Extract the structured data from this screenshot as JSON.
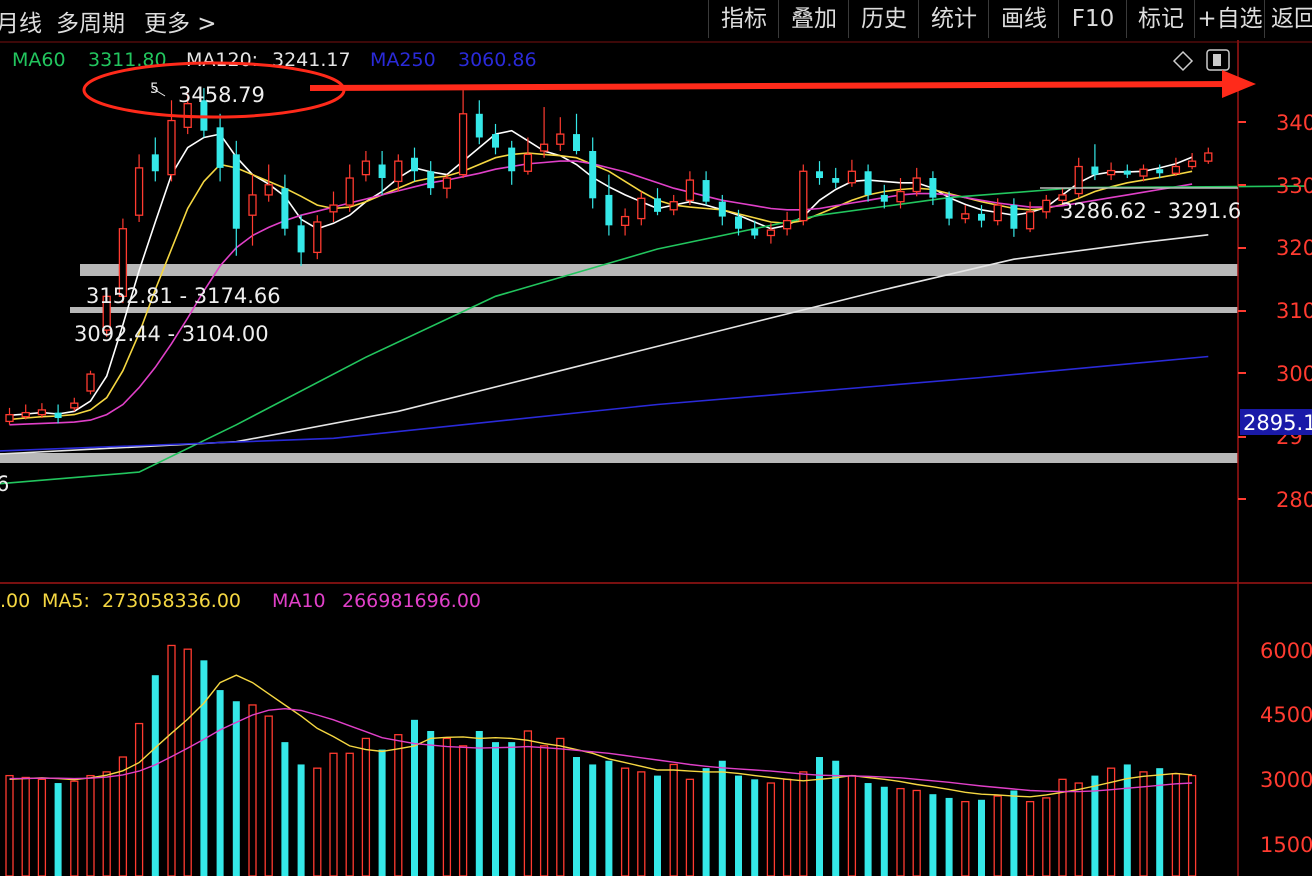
{
  "toolbar": {
    "left": [
      "月线",
      "多周期",
      "更多 >"
    ],
    "right": [
      "指标",
      "叠加",
      "历史",
      "统计",
      "画线",
      "F10",
      "标记",
      "+自选",
      "返回"
    ]
  },
  "price_panel": {
    "ma_legend": [
      {
        "label": "MA60",
        "value": "3311.80",
        "color": "#22c55e"
      },
      {
        "label": "MA120:",
        "value": "3241.17",
        "color": "#e5e5e5"
      },
      {
        "label": "MA250",
        "value": "3060.86",
        "color": "#2a2ad8"
      }
    ],
    "high_label": "3458.79",
    "high_marker": "5",
    "ranges": [
      "3152.81 - 3174.66",
      "3092.44 - 3104.00",
      "3286.62 - 3291.6"
    ],
    "left_edge_label": "6",
    "current_price_tag": "2895.1",
    "y_axis_labels": [
      "340",
      "330",
      "320",
      "310",
      "300",
      "29",
      "280"
    ]
  },
  "volume_panel": {
    "legend": [
      {
        "label": ".00",
        "value": "",
        "color": "#f5d742"
      },
      {
        "label": "MA5:",
        "value": "273058336.00",
        "color": "#f5d742"
      },
      {
        "label": "MA10",
        "value": "266981696.00",
        "color": "#e040c8"
      }
    ],
    "y_axis_labels": [
      "6000",
      "4500",
      "3000",
      "1500"
    ]
  },
  "colors": {
    "up": "#ff3b30",
    "down": "#35e8e8",
    "axis": "#a01515",
    "ma_white": "#ffffff",
    "ma_yellow": "#f5d742",
    "ma_pink": "#e040c8",
    "ma60": "#22c55e",
    "ma120": "#e5e5e5",
    "ma250": "#2a2ad8",
    "annotation": "#ff2a1a"
  },
  "chart_data": {
    "type": "candlestick",
    "price_range": [
      2760,
      3470
    ],
    "candles": [
      {
        "o": 2965,
        "c": 2975,
        "h": 2985,
        "l": 2960
      },
      {
        "o": 2972,
        "c": 2978,
        "h": 2990,
        "l": 2968
      },
      {
        "o": 2975,
        "c": 2982,
        "h": 2992,
        "l": 2970
      },
      {
        "o": 2978,
        "c": 2970,
        "h": 2990,
        "l": 2962
      },
      {
        "o": 2985,
        "c": 2992,
        "h": 3000,
        "l": 2980
      },
      {
        "o": 3010,
        "c": 3035,
        "h": 3040,
        "l": 3005
      },
      {
        "o": 3100,
        "c": 3150,
        "h": 3155,
        "l": 3090
      },
      {
        "o": 3150,
        "c": 3250,
        "h": 3265,
        "l": 3140
      },
      {
        "o": 3270,
        "c": 3340,
        "h": 3360,
        "l": 3260
      },
      {
        "o": 3360,
        "c": 3335,
        "h": 3385,
        "l": 3320
      },
      {
        "o": 3330,
        "c": 3410,
        "h": 3440,
        "l": 3320
      },
      {
        "o": 3400,
        "c": 3435,
        "h": 3450,
        "l": 3390
      },
      {
        "o": 3440,
        "c": 3395,
        "h": 3458,
        "l": 3385
      },
      {
        "o": 3400,
        "c": 3340,
        "h": 3420,
        "l": 3320
      },
      {
        "o": 3360,
        "c": 3250,
        "h": 3380,
        "l": 3210
      },
      {
        "o": 3270,
        "c": 3300,
        "h": 3330,
        "l": 3225
      },
      {
        "o": 3300,
        "c": 3315,
        "h": 3345,
        "l": 3290
      },
      {
        "o": 3310,
        "c": 3250,
        "h": 3330,
        "l": 3240
      },
      {
        "o": 3255,
        "c": 3215,
        "h": 3270,
        "l": 3195
      },
      {
        "o": 3215,
        "c": 3260,
        "h": 3270,
        "l": 3205
      },
      {
        "o": 3275,
        "c": 3285,
        "h": 3305,
        "l": 3260
      },
      {
        "o": 3285,
        "c": 3325,
        "h": 3345,
        "l": 3275
      },
      {
        "o": 3330,
        "c": 3350,
        "h": 3365,
        "l": 3320
      },
      {
        "o": 3345,
        "c": 3325,
        "h": 3365,
        "l": 3300
      },
      {
        "o": 3320,
        "c": 3350,
        "h": 3360,
        "l": 3305
      },
      {
        "o": 3355,
        "c": 3335,
        "h": 3370,
        "l": 3320
      },
      {
        "o": 3335,
        "c": 3310,
        "h": 3350,
        "l": 3300
      },
      {
        "o": 3310,
        "c": 3325,
        "h": 3330,
        "l": 3295
      },
      {
        "o": 3330,
        "c": 3420,
        "h": 3455,
        "l": 3325
      },
      {
        "o": 3420,
        "c": 3385,
        "h": 3440,
        "l": 3375
      },
      {
        "o": 3390,
        "c": 3370,
        "h": 3405,
        "l": 3360
      },
      {
        "o": 3370,
        "c": 3335,
        "h": 3380,
        "l": 3315
      },
      {
        "o": 3335,
        "c": 3360,
        "h": 3385,
        "l": 3330
      },
      {
        "o": 3365,
        "c": 3375,
        "h": 3430,
        "l": 3355
      },
      {
        "o": 3375,
        "c": 3390,
        "h": 3415,
        "l": 3365
      },
      {
        "o": 3390,
        "c": 3365,
        "h": 3420,
        "l": 3360
      },
      {
        "o": 3365,
        "c": 3295,
        "h": 3385,
        "l": 3280
      },
      {
        "o": 3300,
        "c": 3255,
        "h": 3330,
        "l": 3240
      },
      {
        "o": 3255,
        "c": 3268,
        "h": 3280,
        "l": 3240
      },
      {
        "o": 3265,
        "c": 3295,
        "h": 3305,
        "l": 3255
      },
      {
        "o": 3295,
        "c": 3275,
        "h": 3310,
        "l": 3270
      },
      {
        "o": 3278,
        "c": 3290,
        "h": 3300,
        "l": 3270
      },
      {
        "o": 3292,
        "c": 3322,
        "h": 3335,
        "l": 3285
      },
      {
        "o": 3322,
        "c": 3290,
        "h": 3335,
        "l": 3285
      },
      {
        "o": 3290,
        "c": 3268,
        "h": 3300,
        "l": 3255
      },
      {
        "o": 3268,
        "c": 3250,
        "h": 3278,
        "l": 3240
      },
      {
        "o": 3250,
        "c": 3240,
        "h": 3262,
        "l": 3235
      },
      {
        "o": 3240,
        "c": 3248,
        "h": 3258,
        "l": 3228
      },
      {
        "o": 3250,
        "c": 3262,
        "h": 3275,
        "l": 3240
      },
      {
        "o": 3262,
        "c": 3335,
        "h": 3345,
        "l": 3255
      },
      {
        "o": 3335,
        "c": 3325,
        "h": 3350,
        "l": 3315
      },
      {
        "o": 3325,
        "c": 3318,
        "h": 3340,
        "l": 3310
      },
      {
        "o": 3318,
        "c": 3335,
        "h": 3352,
        "l": 3312
      },
      {
        "o": 3335,
        "c": 3300,
        "h": 3345,
        "l": 3290
      },
      {
        "o": 3300,
        "c": 3290,
        "h": 3315,
        "l": 3280
      },
      {
        "o": 3290,
        "c": 3305,
        "h": 3325,
        "l": 3280
      },
      {
        "o": 3305,
        "c": 3325,
        "h": 3340,
        "l": 3298
      },
      {
        "o": 3325,
        "c": 3296,
        "h": 3335,
        "l": 3285
      },
      {
        "o": 3296,
        "c": 3265,
        "h": 3305,
        "l": 3255
      },
      {
        "o": 3265,
        "c": 3272,
        "h": 3285,
        "l": 3258
      },
      {
        "o": 3272,
        "c": 3262,
        "h": 3285,
        "l": 3252
      },
      {
        "o": 3262,
        "c": 3285,
        "h": 3295,
        "l": 3255
      },
      {
        "o": 3285,
        "c": 3250,
        "h": 3295,
        "l": 3238
      },
      {
        "o": 3250,
        "c": 3275,
        "h": 3290,
        "l": 3245
      },
      {
        "o": 3275,
        "c": 3292,
        "h": 3300,
        "l": 3265
      },
      {
        "o": 3292,
        "c": 3300,
        "h": 3310,
        "l": 3285
      },
      {
        "o": 3302,
        "c": 3342,
        "h": 3355,
        "l": 3295
      },
      {
        "o": 3342,
        "c": 3330,
        "h": 3375,
        "l": 3322
      },
      {
        "o": 3330,
        "c": 3336,
        "h": 3348,
        "l": 3322
      },
      {
        "o": 3336,
        "c": 3330,
        "h": 3345,
        "l": 3325
      },
      {
        "o": 3328,
        "c": 3338,
        "h": 3345,
        "l": 3320
      },
      {
        "o": 3338,
        "c": 3332,
        "h": 3345,
        "l": 3325
      },
      {
        "o": 3332,
        "c": 3342,
        "h": 3355,
        "l": 3328
      },
      {
        "o": 3342,
        "c": 3350,
        "h": 3362,
        "l": 3338
      },
      {
        "o": 3350,
        "c": 3362,
        "h": 3370,
        "l": 3346
      }
    ],
    "ma_lines": [
      {
        "key": "ma_white",
        "values": [
          2974,
          2976,
          2978,
          2976,
          2980,
          2995,
          3032,
          3108,
          3188,
          3260,
          3330,
          3370,
          3385,
          3390,
          3356,
          3330,
          3316,
          3298,
          3264,
          3250,
          3258,
          3270,
          3290,
          3305,
          3325,
          3340,
          3334,
          3330,
          3350,
          3370,
          3390,
          3395,
          3380,
          3365,
          3358,
          3345,
          3326,
          3312,
          3300,
          3290,
          3280,
          3285,
          3290,
          3285,
          3278,
          3270,
          3260,
          3250,
          3255,
          3268,
          3292,
          3308,
          3320,
          3322,
          3320,
          3318,
          3318,
          3310,
          3296,
          3286,
          3278,
          3274,
          3270,
          3274,
          3282,
          3300,
          3318,
          3330,
          3334,
          3334,
          3335,
          3340,
          3346,
          3356
        ]
      },
      {
        "key": "ma_yellow",
        "values": [
          2968,
          2970,
          2972,
          2973,
          2975,
          2982,
          3000,
          3040,
          3095,
          3160,
          3220,
          3280,
          3320,
          3345,
          3340,
          3330,
          3320,
          3310,
          3298,
          3285,
          3280,
          3282,
          3290,
          3300,
          3310,
          3320,
          3325,
          3328,
          3335,
          3345,
          3355,
          3360,
          3362,
          3360,
          3358,
          3355,
          3345,
          3335,
          3320,
          3305,
          3292,
          3285,
          3282,
          3280,
          3278,
          3272,
          3266,
          3260,
          3258,
          3262,
          3272,
          3282,
          3292,
          3300,
          3305,
          3308,
          3310,
          3308,
          3302,
          3296,
          3290,
          3285,
          3280,
          3278,
          3280,
          3286,
          3295,
          3305,
          3312,
          3318,
          3322,
          3326,
          3330,
          3335
        ]
      },
      {
        "key": "ma_pink",
        "values": [
          2960,
          2961,
          2962,
          2963,
          2964,
          2967,
          2975,
          2990,
          3015,
          3045,
          3080,
          3118,
          3158,
          3195,
          3222,
          3240,
          3252,
          3262,
          3270,
          3276,
          3282,
          3288,
          3294,
          3300,
          3306,
          3312,
          3318,
          3322,
          3327,
          3332,
          3338,
          3342,
          3346,
          3348,
          3350,
          3350,
          3346,
          3340,
          3334,
          3326,
          3318,
          3310,
          3304,
          3298,
          3292,
          3288,
          3284,
          3280,
          3278,
          3278,
          3280,
          3284,
          3288,
          3292,
          3296,
          3300,
          3302,
          3302,
          3300,
          3296,
          3292,
          3288,
          3285,
          3282,
          3282,
          3284,
          3288,
          3292,
          3296,
          3300,
          3304,
          3308,
          3312,
          3316
        ]
      },
      {
        "key": "ma60",
        "points": [
          [
            -2,
            2870
          ],
          [
            8,
            2890
          ],
          [
            14,
            2960
          ],
          [
            22,
            3060
          ],
          [
            30,
            3150
          ],
          [
            40,
            3220
          ],
          [
            50,
            3270
          ],
          [
            58,
            3296
          ],
          [
            66,
            3311
          ],
          [
            74,
            3312
          ],
          [
            80,
            3313
          ]
        ]
      },
      {
        "key": "ma120",
        "points": [
          [
            -2,
            2915
          ],
          [
            14,
            2935
          ],
          [
            24,
            2980
          ],
          [
            34,
            3040
          ],
          [
            44,
            3100
          ],
          [
            54,
            3160
          ],
          [
            62,
            3205
          ],
          [
            70,
            3230
          ],
          [
            74,
            3241
          ]
        ]
      },
      {
        "key": "ma250",
        "points": [
          [
            -2,
            2920
          ],
          [
            20,
            2940
          ],
          [
            40,
            2990
          ],
          [
            60,
            3030
          ],
          [
            74,
            3061
          ]
        ]
      }
    ],
    "volume_range": [
      0,
      7100
    ],
    "volumes": [
      2700,
      2650,
      2600,
      2500,
      2550,
      2700,
      2800,
      3200,
      4100,
      5400,
      6200,
      6100,
      5800,
      5000,
      4700,
      4600,
      4300,
      3600,
      3000,
      2900,
      3300,
      3300,
      3700,
      3400,
      3800,
      4200,
      3900,
      3700,
      3500,
      3900,
      3600,
      3600,
      3900,
      3500,
      3700,
      3200,
      3000,
      3100,
      2900,
      2800,
      2700,
      3000,
      2600,
      2900,
      3100,
      2700,
      2600,
      2500,
      2600,
      2800,
      3200,
      3100,
      2700,
      2500,
      2400,
      2350,
      2300,
      2200,
      2100,
      2000,
      2050,
      2150,
      2300,
      2000,
      2100,
      2600,
      2500,
      2700,
      2900,
      3000,
      2800,
      2900,
      2750,
      2700
    ],
    "volume_ma": [
      {
        "key": "ma_yellow",
        "values": [
          2600,
          2620,
          2640,
          2620,
          2590,
          2640,
          2710,
          2830,
          3050,
          3450,
          3840,
          4220,
          4650,
          5200,
          5400,
          5200,
          4900,
          4600,
          4300,
          3970,
          3750,
          3500,
          3400,
          3350,
          3420,
          3500,
          3700,
          3730,
          3740,
          3700,
          3720,
          3700,
          3650,
          3560,
          3500,
          3400,
          3300,
          3150,
          3050,
          2950,
          2850,
          2850,
          2820,
          2800,
          2800,
          2760,
          2700,
          2650,
          2600,
          2560,
          2600,
          2640,
          2700,
          2650,
          2600,
          2540,
          2460,
          2400,
          2330,
          2250,
          2200,
          2180,
          2150,
          2130,
          2180,
          2250,
          2330,
          2420,
          2520,
          2620,
          2680,
          2720,
          2760,
          2720
        ]
      },
      {
        "key": "ma_pink",
        "values": [
          2620,
          2625,
          2630,
          2630,
          2620,
          2630,
          2660,
          2720,
          2820,
          2990,
          3210,
          3440,
          3680,
          3930,
          4130,
          4330,
          4460,
          4500,
          4450,
          4330,
          4200,
          4040,
          3880,
          3720,
          3640,
          3560,
          3520,
          3480,
          3460,
          3440,
          3450,
          3460,
          3480,
          3450,
          3420,
          3380,
          3340,
          3300,
          3240,
          3180,
          3120,
          3060,
          3000,
          2950,
          2910,
          2880,
          2850,
          2820,
          2780,
          2740,
          2710,
          2700,
          2690,
          2680,
          2660,
          2640,
          2600,
          2560,
          2520,
          2470,
          2420,
          2380,
          2340,
          2300,
          2280,
          2270,
          2270,
          2290,
          2320,
          2360,
          2400,
          2440,
          2480,
          2500
        ]
      }
    ]
  }
}
